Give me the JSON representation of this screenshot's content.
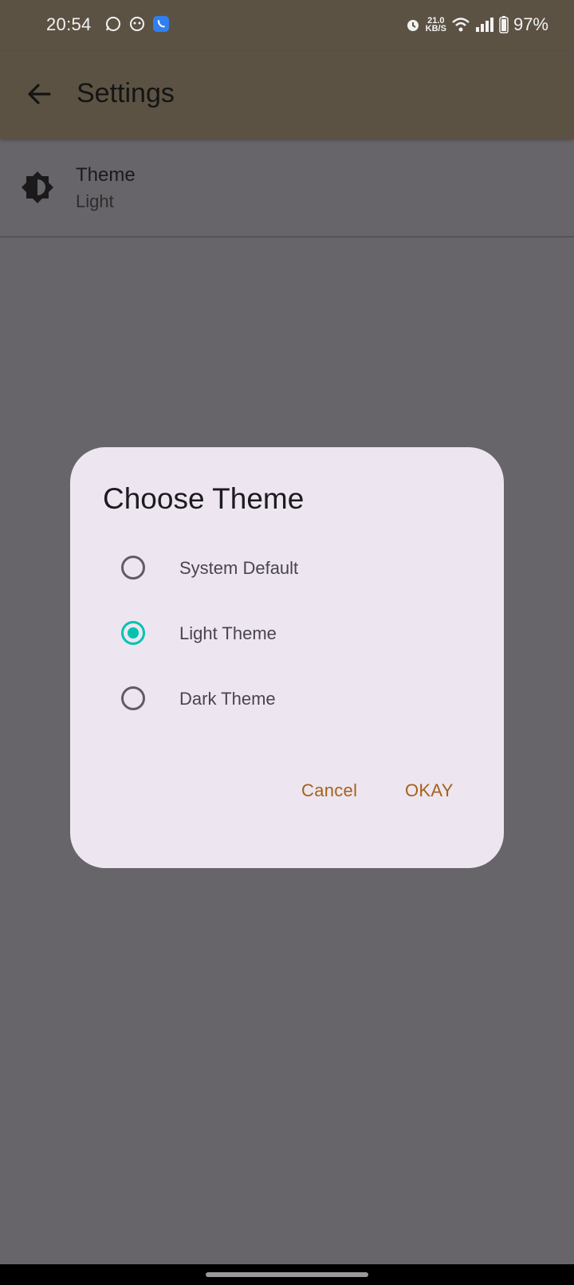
{
  "status_bar": {
    "time": "20:54",
    "net_speed_value": "21.0",
    "net_speed_unit": "KB/S",
    "battery": "97%"
  },
  "app_bar": {
    "title": "Settings",
    "back_icon": "arrow-back-icon"
  },
  "settings": {
    "theme_row": {
      "icon": "brightness-icon",
      "title": "Theme",
      "value": "Light"
    }
  },
  "dialog": {
    "title": "Choose Theme",
    "options": [
      {
        "label": "System Default",
        "selected": false
      },
      {
        "label": "Light Theme",
        "selected": true
      },
      {
        "label": "Dark Theme",
        "selected": false
      }
    ],
    "cancel_label": "Cancel",
    "ok_label": "OKAY"
  },
  "colors": {
    "accent": "#00c4b0",
    "button_text": "#a5611c",
    "dialog_bg": "#ede6f0",
    "scrim": "#676569"
  }
}
